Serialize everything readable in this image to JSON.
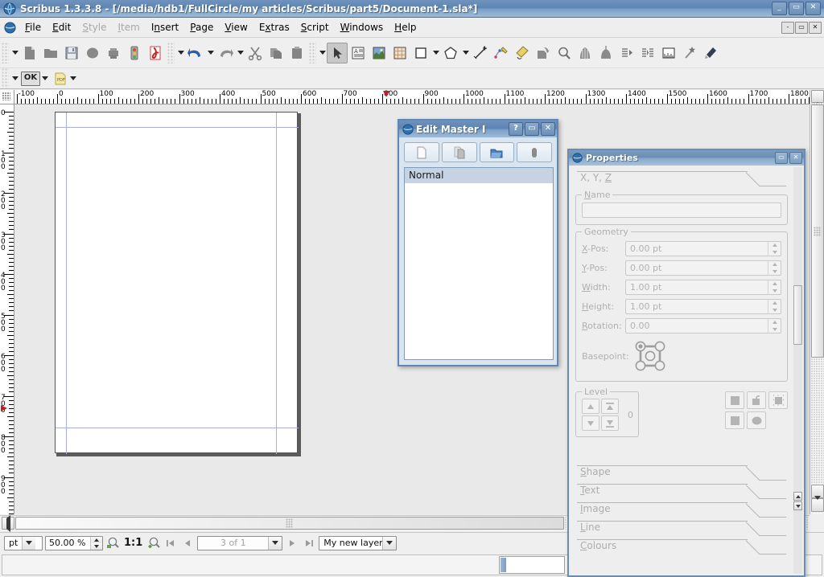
{
  "window": {
    "title": "Scribus 1.3.3.8 - [/media/hdb1/FullCircle/my articles/Scribus/part5/Document-1.sla*]",
    "minimize": "_",
    "restore": "▭",
    "close": "✕"
  },
  "menubar": {
    "items": [
      {
        "label": "File",
        "accel": "F",
        "disabled": false
      },
      {
        "label": "Edit",
        "accel": "E",
        "disabled": false
      },
      {
        "label": "Style",
        "accel": "S",
        "disabled": true
      },
      {
        "label": "Item",
        "accel": "I",
        "disabled": true
      },
      {
        "label": "Insert",
        "accel": "n",
        "disabled": false
      },
      {
        "label": "Page",
        "accel": "P",
        "disabled": false
      },
      {
        "label": "View",
        "accel": "V",
        "disabled": false
      },
      {
        "label": "Extras",
        "accel": "x",
        "disabled": false
      },
      {
        "label": "Script",
        "accel": "S",
        "disabled": false
      },
      {
        "label": "Windows",
        "accel": "W",
        "disabled": false
      },
      {
        "label": "Help",
        "accel": "H",
        "disabled": false
      }
    ],
    "doc_minimize": "-",
    "doc_restore": "▭",
    "doc_close": "✕"
  },
  "toolbar_main": {
    "tools": [
      {
        "name": "new-document",
        "icon": "page"
      },
      {
        "name": "open-document",
        "icon": "folder"
      },
      {
        "name": "save-document",
        "icon": "floppy"
      },
      {
        "name": "close-document",
        "icon": "blob"
      },
      {
        "name": "print-document",
        "icon": "printer"
      },
      {
        "name": "preflight-verifier",
        "icon": "trafficlight"
      },
      {
        "name": "save-as-pdf",
        "icon": "pdf"
      },
      {
        "name": "undo",
        "icon": "undo-arrow"
      },
      {
        "name": "redo",
        "icon": "redo-arrow"
      },
      {
        "name": "cut",
        "icon": "scissors"
      },
      {
        "name": "copy",
        "icon": "copy-pages"
      },
      {
        "name": "paste",
        "icon": "clipboard"
      },
      {
        "name": "select-item",
        "icon": "cursor-arrow",
        "selected": true
      },
      {
        "name": "insert-text-frame",
        "icon": "text-frame"
      },
      {
        "name": "insert-image-frame",
        "icon": "image-frame"
      },
      {
        "name": "insert-table",
        "icon": "table"
      },
      {
        "name": "insert-shape",
        "icon": "square"
      },
      {
        "name": "insert-polygon",
        "icon": "pentagon"
      },
      {
        "name": "insert-line",
        "icon": "line"
      },
      {
        "name": "insert-bezier-curve",
        "icon": "bezier"
      },
      {
        "name": "insert-freehand-line",
        "icon": "pencil"
      },
      {
        "name": "rotate-item",
        "icon": "rotate"
      },
      {
        "name": "zoom",
        "icon": "magnifier"
      },
      {
        "name": "edit-contents",
        "icon": "edit-contents"
      },
      {
        "name": "edit-text-with-story-editor",
        "icon": "story-editor"
      },
      {
        "name": "link-text-frames",
        "icon": "link-frames"
      },
      {
        "name": "unlink-text-frames",
        "icon": "unlink-frames"
      },
      {
        "name": "measurements",
        "icon": "ruler"
      },
      {
        "name": "copy-item-properties",
        "icon": "magic-wand"
      },
      {
        "name": "eye-dropper",
        "icon": "eyedropper"
      }
    ]
  },
  "toolbar_pdf": {
    "ok_label": "OK",
    "pdf_label": "PDF"
  },
  "rulers": {
    "unit": "pt",
    "horizontal_labels": [
      "-100",
      "0",
      "100",
      "200",
      "300",
      "400",
      "500",
      "600",
      "700",
      "800",
      "900",
      "1000",
      "1100",
      "1200",
      "1300",
      "1400",
      "1500",
      "1600",
      "1700",
      "1800"
    ],
    "vertical_labels": [
      "0",
      "100",
      "200",
      "300",
      "400",
      "500",
      "600",
      "700",
      "800",
      "900"
    ],
    "h_marker_value": 810,
    "v_marker_value": 730
  },
  "dialog": {
    "title": "Edit Master I",
    "help_btn": "?",
    "max_btn": "▭",
    "close_btn": "✕",
    "tool_buttons": [
      {
        "name": "add-new-master-page",
        "icon": "new-page"
      },
      {
        "name": "duplicate-master-page",
        "icon": "duplicate-page"
      },
      {
        "name": "import-master-page",
        "icon": "import-folder"
      },
      {
        "name": "delete-master-page",
        "icon": "delete-page"
      }
    ],
    "list_items": [
      {
        "label": "Normal",
        "selected": true
      }
    ]
  },
  "properties": {
    "title": "Properties",
    "max_btn": "▭",
    "close_btn": "✕",
    "tab_xyz": {
      "label": "X, Y, Z",
      "accel": "Z"
    },
    "name_group": {
      "legend": "Name",
      "value": "",
      "accel": "N"
    },
    "geometry_group": {
      "legend": "Geometry",
      "fields": [
        {
          "label": "X-Pos:",
          "accel": "X",
          "value": "0.00 pt"
        },
        {
          "label": "Y-Pos:",
          "accel": "Y",
          "value": "0.00 pt"
        },
        {
          "label": "Width:",
          "accel": "W",
          "value": "1.00 pt"
        },
        {
          "label": "Height:",
          "accel": "H",
          "value": "1.00 pt"
        },
        {
          "label": "Rotation:",
          "accel": "R",
          "value": "0.00"
        }
      ],
      "basepoint_label": "Basepoint:",
      "basepoint_selected": "top-left"
    },
    "level_group": {
      "legend": "Level",
      "value": "0",
      "buttons": [
        {
          "name": "raise-one-level",
          "icon": "arrow-up"
        },
        {
          "name": "raise-to-top",
          "icon": "arrow-up-bar"
        },
        {
          "name": "lower-one-level",
          "icon": "arrow-down"
        },
        {
          "name": "lower-to-bottom",
          "icon": "arrow-down-bar"
        }
      ]
    },
    "flag_buttons": [
      {
        "name": "lock-item",
        "icon": "padlock"
      },
      {
        "name": "lock-size",
        "icon": "size-lock"
      },
      {
        "name": "enable-printing",
        "icon": "printer-toggle"
      },
      {
        "name": "disable-item",
        "icon": "square-flag"
      },
      {
        "name": "flip-item",
        "icon": "blob-flag"
      }
    ],
    "collapsed_tabs": [
      {
        "label": "Shape",
        "accel": "S"
      },
      {
        "label": "Text",
        "accel": "T"
      },
      {
        "label": "Image",
        "accel": "I"
      },
      {
        "label": "Line",
        "accel": "L"
      },
      {
        "label": "Colours",
        "accel": "C"
      }
    ]
  },
  "statusbar": {
    "unit_value": "pt",
    "zoom_value": "50.00 %",
    "zoom_out_icon": "zoom-out-icon",
    "ratio_label": "1:1",
    "zoom_in_icon": "zoom-in-icon",
    "nav_first": "first-page-icon",
    "nav_prev": "previous-page-icon",
    "page_value": "3 of 1",
    "nav_next": "next-page-icon",
    "nav_last": "last-page-icon",
    "layer_value": "My new layer"
  }
}
